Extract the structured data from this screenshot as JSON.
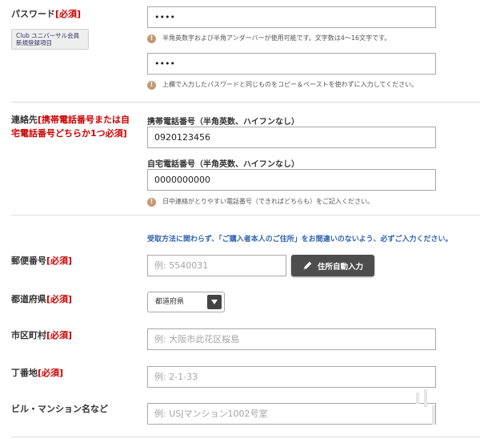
{
  "password": {
    "label": "パスワード",
    "required": "[必須]",
    "badge": "Club ユニバーサル会員 新規登録項目",
    "value": "••••",
    "note": "半角英数字および半角アンダーバーが使用可能です。文字数は4〜16文字です。",
    "confirm_value": "••••",
    "confirm_note": "上欄で入力したパスワードと同じものをコピー＆ペーストを使わずに入力してください。"
  },
  "contact": {
    "label": "連絡先",
    "required_line1": "[携帯電話番号または自",
    "required_line2": "宅電話番号どちらか1つ必須]",
    "mobile_label": "携帯電話番号（半角英数、ハイフンなし）",
    "mobile_value": "0920123456",
    "home_label": "自宅電話番号（半角英数、ハイフンなし）",
    "home_value": "0000000000",
    "note": "日中連絡がとりやすい電話番号（できればどちらも）をご記入ください。"
  },
  "address": {
    "notice": "受取方法に関わらず、「ご購入者本人のご住所」をお間違いのないよう、必ずご入力ください。",
    "postal_label": "郵便番号",
    "postal_required": "[必須]",
    "postal_placeholder": "例: 5540031",
    "auto_button": "住所自動入力",
    "pref_label": "都道府県",
    "pref_required": "[必須]",
    "pref_value": "都道府県",
    "city_label": "市区町村",
    "city_required": "[必須]",
    "city_placeholder": "例: 大阪市此花区桜島",
    "block_label": "丁番地",
    "block_required": "[必須]",
    "block_placeholder": "例: 2-1-33",
    "building_label": "ビル・マンション名など",
    "building_placeholder": "例: USJマンション1002号室"
  },
  "icons": {
    "warning": "!",
    "pencil": "pencil-icon",
    "dropdown": "triangle-down-icon"
  },
  "colors": {
    "required": "#cc0000",
    "notice": "#2f63b0",
    "warning": "#c29a73",
    "button": "#4d4d4d"
  }
}
